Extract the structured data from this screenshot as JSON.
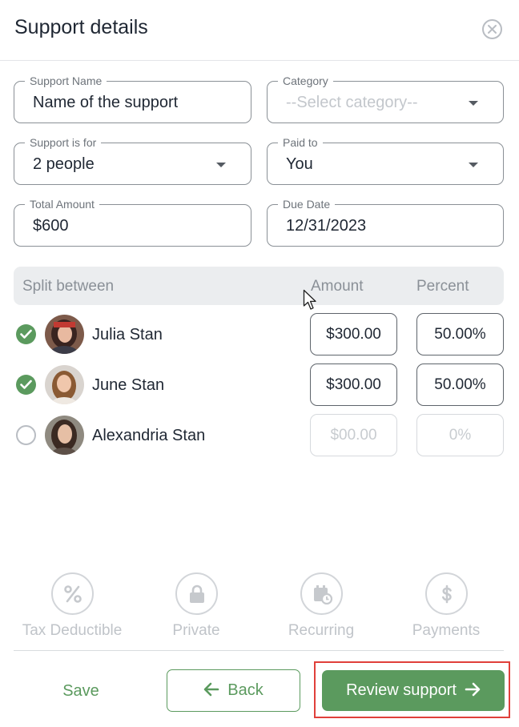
{
  "header": {
    "title": "Support details",
    "close_icon": "close-circle-icon"
  },
  "fields": {
    "support_name": {
      "label": "Support Name",
      "value": "Name of the support"
    },
    "category": {
      "label": "Category",
      "placeholder": "--Select category--"
    },
    "support_for": {
      "label": "Support is for",
      "value": "2 people"
    },
    "paid_to": {
      "label": "Paid to",
      "value": "You"
    },
    "total_amount": {
      "label": "Total Amount",
      "value": "$600"
    },
    "due_date": {
      "label": "Due Date",
      "value": "12/31/2023"
    }
  },
  "split": {
    "header": {
      "name": "Split between",
      "amount": "Amount",
      "percent": "Percent"
    },
    "people": [
      {
        "name": "Julia Stan",
        "checked": true,
        "amount": "$300.00",
        "percent": "50.00%"
      },
      {
        "name": "June Stan",
        "checked": true,
        "amount": "$300.00",
        "percent": "50.00%"
      },
      {
        "name": "Alexandria Stan",
        "checked": false,
        "amount": "$00.00",
        "percent": "0%"
      }
    ]
  },
  "options": [
    {
      "label": "Tax Deductible",
      "icon": "percent-icon"
    },
    {
      "label": "Private",
      "icon": "lock-icon"
    },
    {
      "label": "Recurring",
      "icon": "calendar-clock-icon"
    },
    {
      "label": "Payments",
      "icon": "dollar-icon"
    }
  ],
  "footer": {
    "save": "Save",
    "back": "Back",
    "review": "Review support"
  },
  "colors": {
    "accent": "#5b9a5e",
    "highlight_border": "#e0403a",
    "text": "#1f2733",
    "muted": "#c0c4c9"
  }
}
